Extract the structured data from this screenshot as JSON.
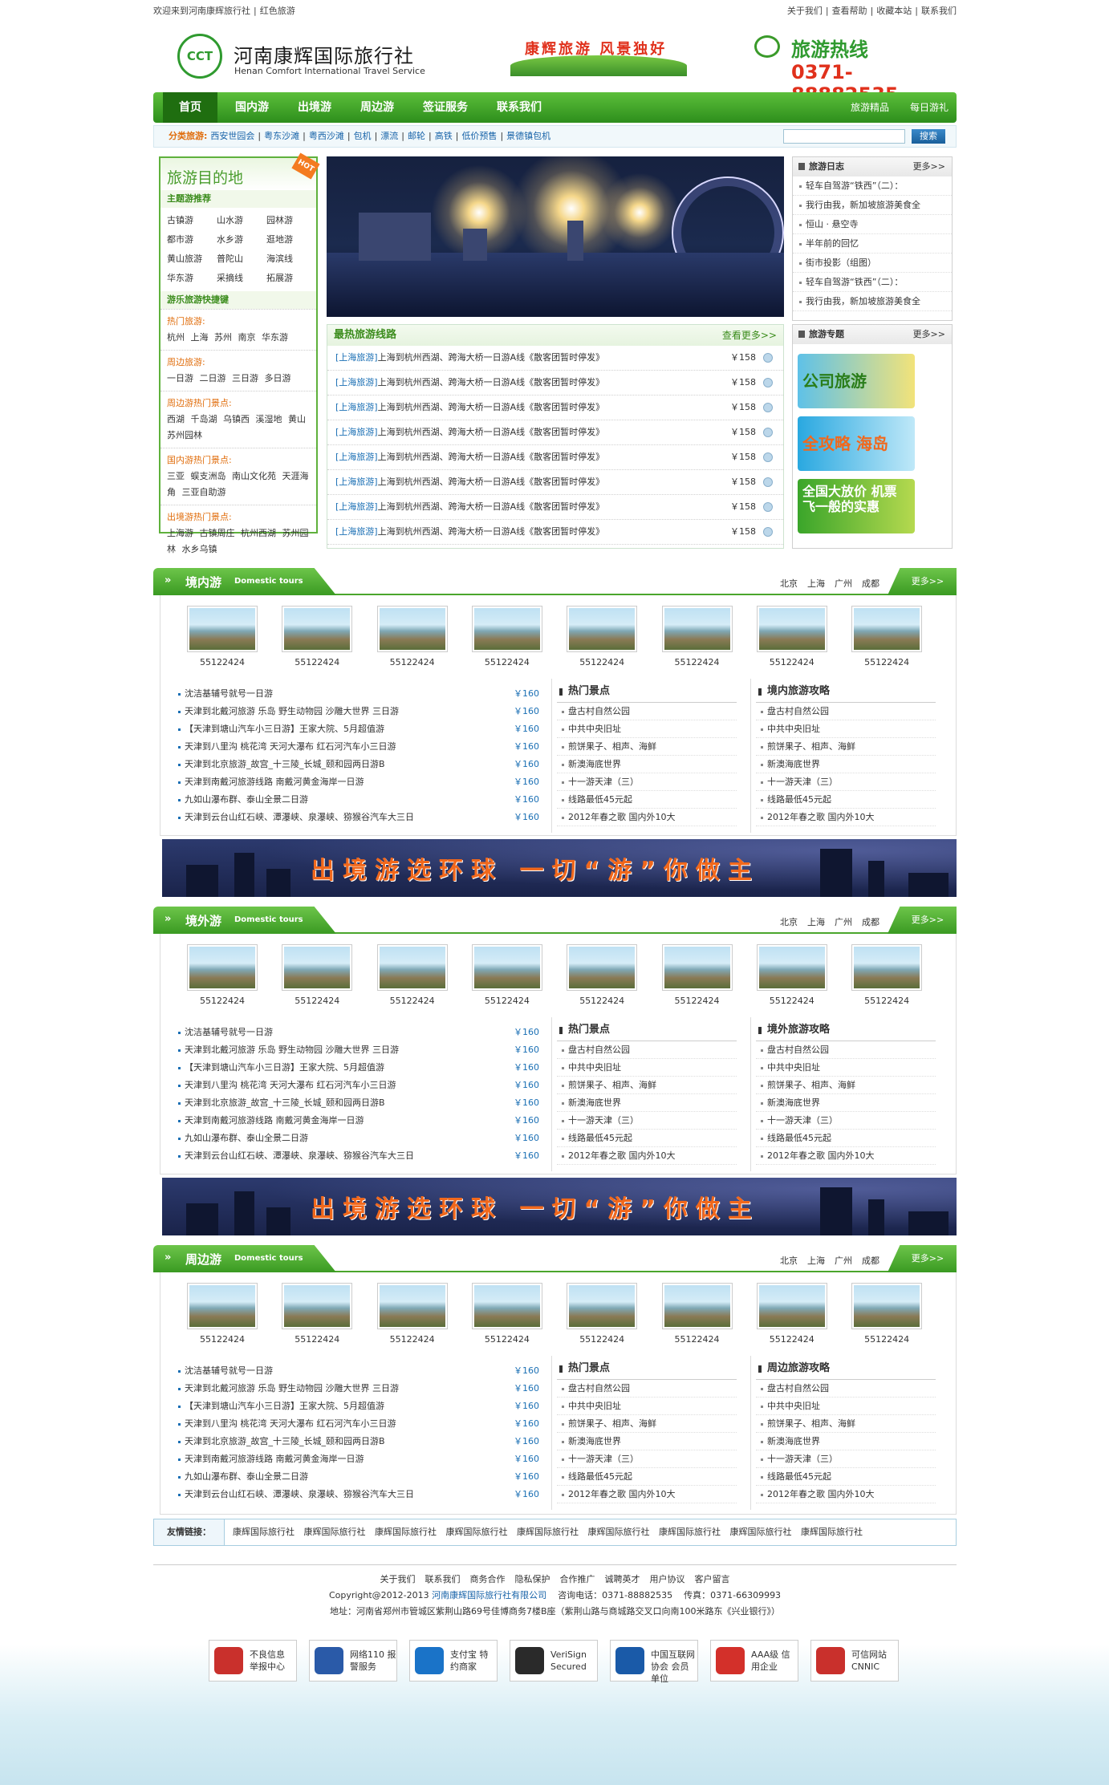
{
  "topbar": {
    "welcome": "欢迎来到河南康辉旅行社",
    "red_tour": "红色旅游",
    "links": [
      "关于我们",
      "查看帮助",
      "收藏本站",
      "联系我们"
    ]
  },
  "header": {
    "logo_mark": "CCT",
    "name_cn": "河南康辉国际旅行社",
    "name_en": "Henan Comfort International Travel Service",
    "slogan": "康辉旅游 风景独好",
    "hotline_label": "旅游热线",
    "hotline_number": "0371-88882535"
  },
  "nav": {
    "items": [
      "首页",
      "国内游",
      "出境游",
      "周边游",
      "签证服务",
      "联系我们"
    ],
    "right": [
      "旅游精品",
      "每日游礼"
    ]
  },
  "catbar": {
    "label": "分类旅游:",
    "items": [
      "西安世园会",
      "粤东沙滩",
      "粤西沙滩",
      "包机",
      "漂流",
      "邮轮",
      "高铁",
      "低价预售",
      "景德镇包机"
    ],
    "search_button": "搜索"
  },
  "left": {
    "title": "旅游目的地",
    "hot_badge": "HOT",
    "theme_title": "主题游推荐",
    "themes": [
      "古镇游",
      "山水游",
      "园林游",
      "都市游",
      "水乡游",
      "逛地游",
      "黄山旅游",
      "普陀山",
      "海滨线",
      "华东游",
      "采摘线",
      "拓展游"
    ],
    "quick_title": "游乐旅游快捷键",
    "groups": [
      {
        "title": "热门旅游:",
        "value": "杭州 上海 苏州 南京 华东游"
      },
      {
        "title": "周边旅游:",
        "value": "一日游 二日游 三日游 多日游"
      },
      {
        "title": "周边游热门景点:",
        "value": "西湖 千岛湖 乌镇西 溪湿地 黄山 苏州园林"
      },
      {
        "title": "国内游热门景点:",
        "value": "三亚 蜈支洲岛 南山文化苑 天涯海角 三亚自助游"
      },
      {
        "title": "出境游热门景点:",
        "value": "上海游 古镇周庄 杭州西湖 苏州园林 水乡乌镇"
      }
    ]
  },
  "hot_lines": {
    "title": "最热旅游线路",
    "more": "查看更多>>",
    "rows": [
      {
        "tag": "[上海旅游]",
        "text": "上海到杭州西湖、跨海大桥一日游A线《散客团暂时停发》",
        "price": "￥158"
      },
      {
        "tag": "[上海旅游]",
        "text": "上海到杭州西湖、跨海大桥一日游A线《散客团暂时停发》",
        "price": "￥158"
      },
      {
        "tag": "[上海旅游]",
        "text": "上海到杭州西湖、跨海大桥一日游A线《散客团暂时停发》",
        "price": "￥158"
      },
      {
        "tag": "[上海旅游]",
        "text": "上海到杭州西湖、跨海大桥一日游A线《散客团暂时停发》",
        "price": "￥158"
      },
      {
        "tag": "[上海旅游]",
        "text": "上海到杭州西湖、跨海大桥一日游A线《散客团暂时停发》",
        "price": "￥158"
      },
      {
        "tag": "[上海旅游]",
        "text": "上海到杭州西湖、跨海大桥一日游A线《散客团暂时停发》",
        "price": "￥158"
      },
      {
        "tag": "[上海旅游]",
        "text": "上海到杭州西湖、跨海大桥一日游A线《散客团暂时停发》",
        "price": "￥158"
      },
      {
        "tag": "[上海旅游]",
        "text": "上海到杭州西湖、跨海大桥一日游A线《散客团暂时停发》",
        "price": "￥158"
      }
    ]
  },
  "diary": {
    "title": "旅游日志",
    "more": "更多>>",
    "items": [
      "轻车自驾游“铁西”（二）：",
      "我行由我，新加坡旅游美食全",
      "恒山 · 悬空寺",
      "半年前的回忆",
      "街市投影（组图）",
      "轻车自驾游“铁西”（二）：",
      "我行由我，新加坡旅游美食全"
    ]
  },
  "special": {
    "title": "旅游专题",
    "more": "更多>>",
    "ads": [
      "公司旅游",
      "全攻略 海岛",
      "全国大放价 机票 飞一般的实惠"
    ]
  },
  "sections": [
    {
      "cn": "境内游",
      "en": "Domestic tours",
      "col3_title": "境内旅游攻略"
    },
    {
      "cn": "境外游",
      "en": "Domestic tours",
      "col3_title": "境外旅游攻略"
    },
    {
      "cn": "周边游",
      "en": "Domestic tours",
      "col3_title": "周边旅游攻略"
    }
  ],
  "section_common": {
    "arrows": "»",
    "cities": [
      "北京",
      "上海",
      "广州",
      "成都"
    ],
    "more": "更多>>",
    "thumb_caption": "55122424",
    "lines": [
      {
        "text": "沈洁基辅号就号一日游",
        "price": "￥160"
      },
      {
        "text": "天津到北戴河旅游 乐岛 野生动物园 沙雕大世界 三日游",
        "price": "￥160"
      },
      {
        "text": "【天津到塘山汽车小三日游】王家大院、5月超值游",
        "price": "￥160"
      },
      {
        "text": "天津到八里沟 桃花湾 天河大瀑布 红石河汽车小三日游",
        "price": "￥160"
      },
      {
        "text": "天津到北京旅游_故宫_十三陵_长城_颐和园两日游B",
        "price": "￥160"
      },
      {
        "text": "天津到南戴河旅游线路 南戴河黄金海岸一日游",
        "price": "￥160"
      },
      {
        "text": "九如山瀑布群、泰山全景二日游",
        "price": "￥160"
      },
      {
        "text": "天津到云台山红石峡、潭瀑峡、泉瀑峡、猕猴谷汽车大三日",
        "price": "￥160"
      }
    ],
    "col2_title": "热门景点",
    "spots": [
      "盘古村自然公园",
      "中共中央旧址",
      "煎饼果子、相声、海鲜",
      "新澳海底世界",
      "十一游天津（三）",
      "线路最低45元起",
      "2012年春之歌 国内外10大"
    ]
  },
  "wide_banner": {
    "text": "出境游选环球 一切“游”你做主"
  },
  "friends": {
    "title": "友情链接：",
    "links": [
      "康辉国际旅行社",
      "康辉国际旅行社",
      "康辉国际旅行社",
      "康辉国际旅行社",
      "康辉国际旅行社",
      "康辉国际旅行社",
      "康辉国际旅行社",
      "康辉国际旅行社",
      "康辉国际旅行社"
    ]
  },
  "footer": {
    "links": [
      "关于我们",
      "联系我们",
      "商务合作",
      "隐私保护",
      "合作推广",
      "诚聘英才",
      "用户协议",
      "客户留言"
    ],
    "copyright": "Copyright@2012-2013",
    "company": "河南康辉国际旅行社有限公司",
    "phone": "咨询电话：0371-88882535",
    "fax": "传真：0371-66309993",
    "address": "地址：河南省郑州市管城区紫荆山路69号佳博商务7楼B座（紫荆山路与商城路交叉口向南100米路东《兴业银行》）",
    "badges": [
      "不良信息 举报中心",
      "网络110 报警服务",
      "支付宝 特约商家",
      "VeriSign Secured",
      "中国互联网协会 会员单位",
      "AAA级 信用企业",
      "可信网站 CNNIC"
    ]
  },
  "colors": {
    "brand_green": "#3a9a22",
    "accent_orange": "#f1681c",
    "hotline_red": "#e0311c",
    "link_blue": "#1a6fb4"
  }
}
